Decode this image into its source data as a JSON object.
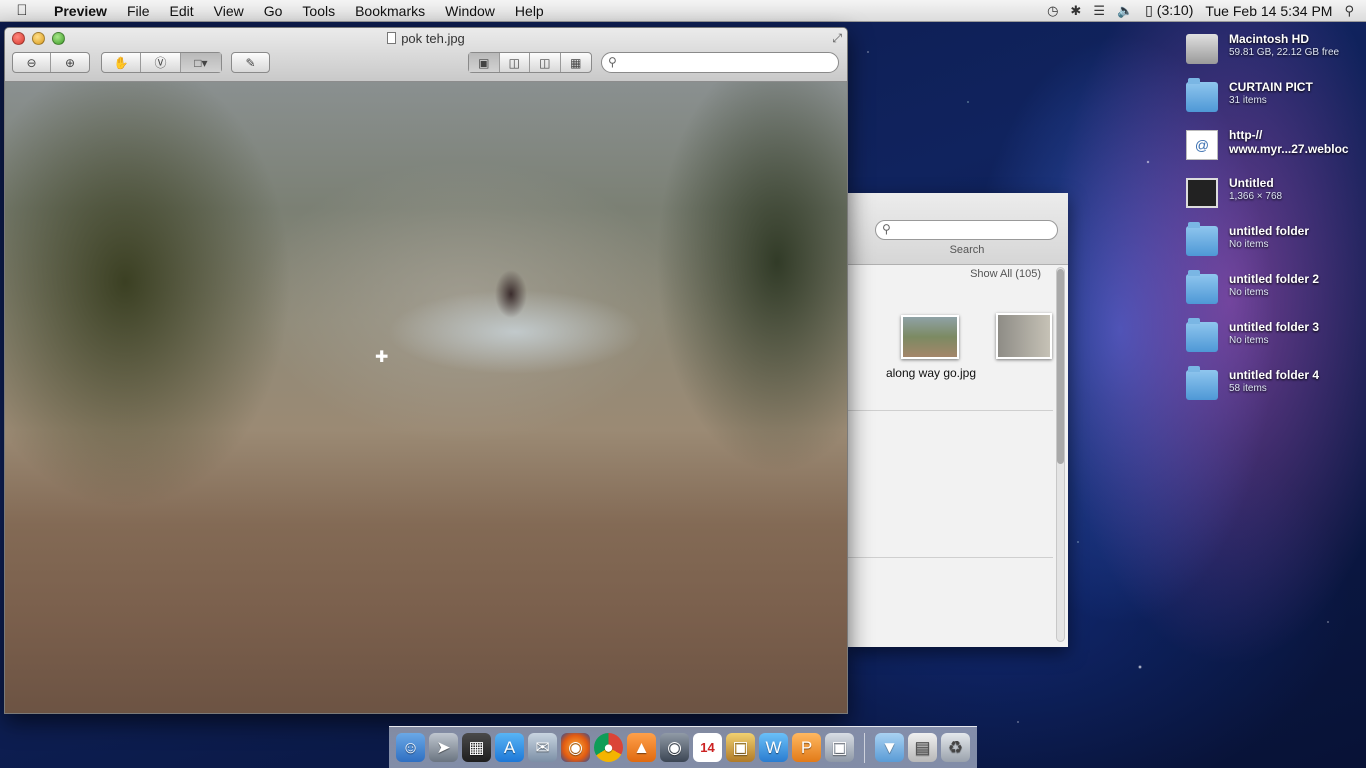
{
  "menubar": {
    "app_name": "Preview",
    "items": [
      "File",
      "Edit",
      "View",
      "Go",
      "Tools",
      "Bookmarks",
      "Window",
      "Help"
    ],
    "battery": "(3:10)",
    "clock": "Tue Feb 14  5:34 PM"
  },
  "preview": {
    "title": "pok teh.jpg",
    "search_placeholder": ""
  },
  "back_window": {
    "search_label": "Search",
    "show_all": "Show All (105)",
    "thumb_label": "along way go.jpg"
  },
  "desktop": {
    "items": [
      {
        "name": "Macintosh HD",
        "sub": "59.81 GB, 22.12 GB free",
        "icon": "hard-drive-icon"
      },
      {
        "name": "CURTAIN PICT",
        "sub": "31 items",
        "icon": "folder-icon"
      },
      {
        "name": "http-//",
        "sub": "www.myr...27.webloc",
        "icon": "webloc-icon"
      },
      {
        "name": "Untitled",
        "sub": "1,366 × 768",
        "icon": "image-file-icon"
      },
      {
        "name": "untitled folder",
        "sub": "No items",
        "icon": "folder-icon"
      },
      {
        "name": "untitled folder 2",
        "sub": "No items",
        "icon": "folder-icon"
      },
      {
        "name": "untitled folder 3",
        "sub": "No items",
        "icon": "folder-icon"
      },
      {
        "name": "untitled folder 4",
        "sub": "58 items",
        "icon": "folder-icon"
      }
    ]
  },
  "dock": {
    "calendar_day": "14"
  }
}
